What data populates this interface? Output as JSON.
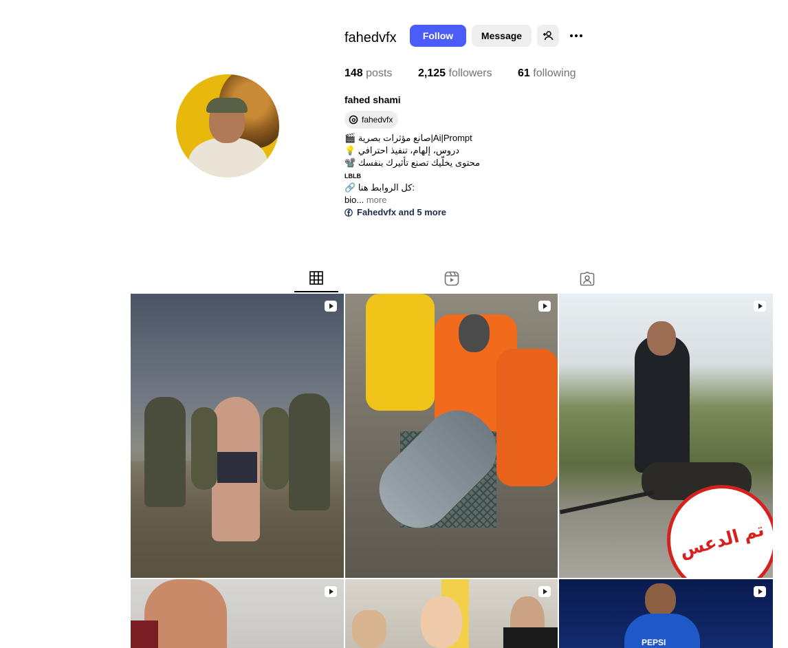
{
  "profile": {
    "username": "fahedvfx",
    "follow_label": "Follow",
    "message_label": "Message",
    "posts_count": "148",
    "posts_label": "posts",
    "followers_count": "2,125",
    "followers_label": "followers",
    "following_count": "61",
    "following_label": "following",
    "full_name": "fahed shami",
    "threads_handle": "fahedvfx",
    "bio_lines": [
      "🎬 صانع مؤثرات بصرية|Ai|Prompt",
      "💡 دروس، إلهام، تنفيذ احترافي",
      "📽️ محتوى يخلّيك تصنع تأثيرك بنفسك"
    ],
    "bio_small": "LBLB",
    "bio_links_line": "🔗 كل الروابط هنا:",
    "bio_truncated": "bio...",
    "more_label": "more",
    "links_label": "Fahedvfx and 5 more"
  },
  "tabs": [
    {
      "name": "posts",
      "icon": "grid-icon",
      "active": true
    },
    {
      "name": "reels",
      "icon": "reels-icon",
      "active": false
    },
    {
      "name": "tagged",
      "icon": "tagged-icon",
      "active": false
    }
  ],
  "posts": [
    {
      "type": "reel",
      "caption_icon": "reel-icon"
    },
    {
      "type": "reel",
      "caption_icon": "reel-icon"
    },
    {
      "type": "reel",
      "caption_icon": "reel-icon",
      "overlay_text": "تم الدعس"
    },
    {
      "type": "reel",
      "caption_icon": "reel-icon"
    },
    {
      "type": "reel",
      "caption_icon": "reel-icon"
    },
    {
      "type": "reel",
      "caption_icon": "reel-icon",
      "overlay_text": "PEPSI"
    }
  ],
  "colors": {
    "accent": "#4a5df9",
    "button_bg": "#efefef",
    "muted": "#737373"
  }
}
